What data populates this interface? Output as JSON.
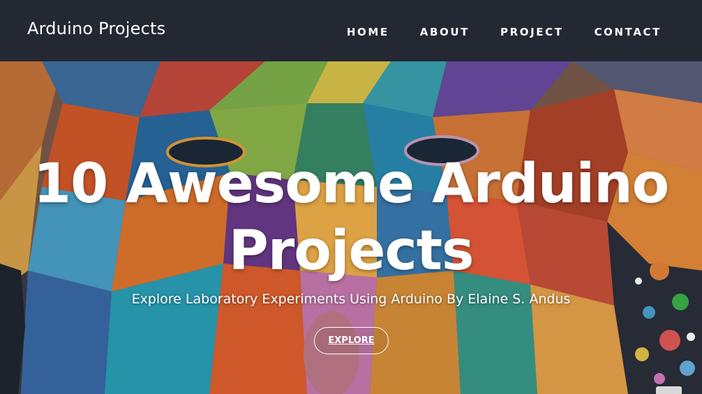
{
  "nav": {
    "brand": "Arduino Projects",
    "links": [
      {
        "label": "HOME"
      },
      {
        "label": "ABOUT"
      },
      {
        "label": "PROJECT"
      },
      {
        "label": "CONTACT"
      }
    ]
  },
  "hero": {
    "title_line1": "10 Awesome Arduino",
    "title_line2": "Projects",
    "subtitle": "Explore Laboratory Experiments Using Arduino By Elaine S. Andus",
    "button_label": "EXPLORE"
  },
  "colors": {
    "navbar_bg": "#232833",
    "text": "#ffffff"
  }
}
